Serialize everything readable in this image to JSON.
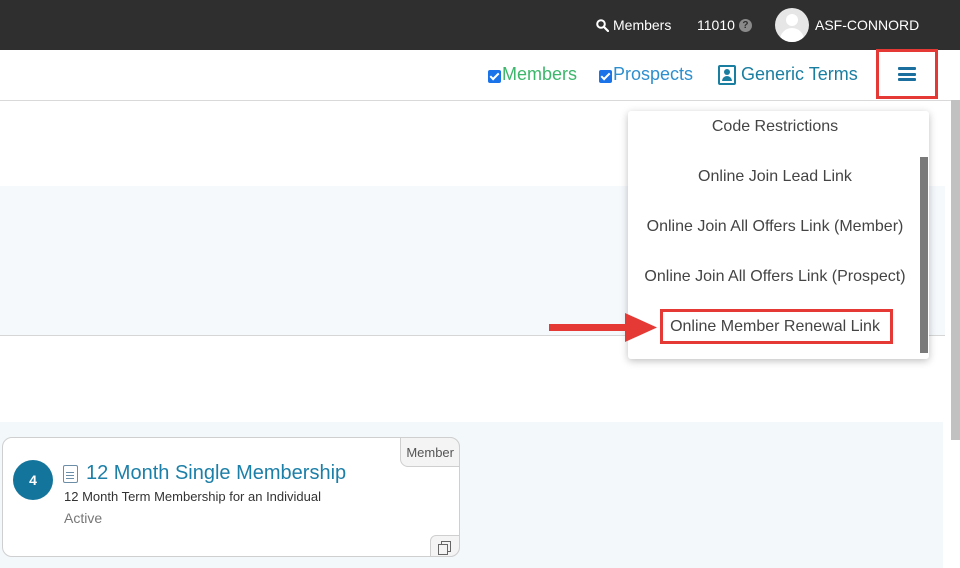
{
  "topbar": {
    "members_label": "Members",
    "account_number": "11010",
    "help_glyph": "?",
    "username": "ASF-CONNORD"
  },
  "filters": {
    "members_label": "Members",
    "prospects_label": "Prospects",
    "generic_terms_label": "Generic Terms"
  },
  "dropdown": {
    "items": [
      "Code Restrictions",
      "Online Join Lead Link",
      "Online Join All Offers Link (Member)",
      "Online Join All Offers Link (Prospect)",
      "Online Member Renewal Link"
    ]
  },
  "card": {
    "number": "4",
    "title": "12 Month Single Membership",
    "description": "12 Month Term Membership for an Individual",
    "status": "Active",
    "type_tag": "Member"
  },
  "colors": {
    "topbar": "#2f2f2f",
    "highlight": "#e53935",
    "members": "#3cb66b",
    "prospects": "#2e8fcf",
    "link": "#1c7fa8",
    "badge": "#14759c"
  },
  "icons": [
    "search-icon",
    "help-icon",
    "avatar",
    "checkbox",
    "contact-card-icon",
    "hamburger-icon",
    "document-icon",
    "copy-icon",
    "annotation-arrow"
  ]
}
